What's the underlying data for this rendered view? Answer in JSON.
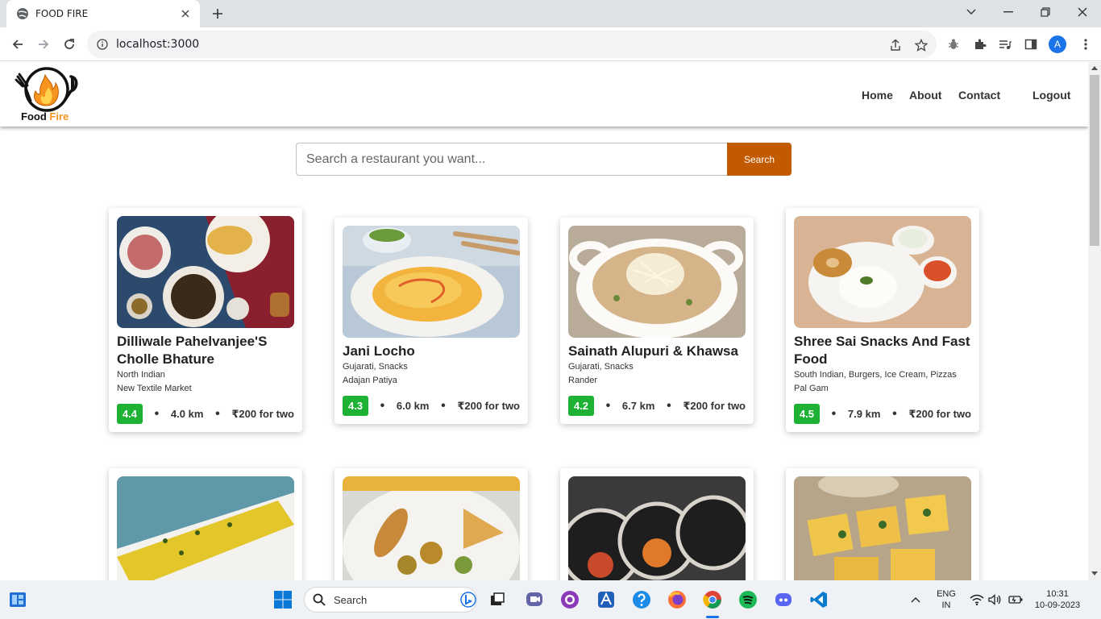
{
  "browser": {
    "tab_title": "FOOD FIRE",
    "url": "localhost:3000",
    "profile_initial": "A"
  },
  "site": {
    "logo_word1": "Food",
    "logo_word2": "Fire",
    "nav": [
      "Home",
      "About",
      "Contact",
      "Logout"
    ],
    "search_placeholder": "Search a restaurant you want...",
    "search_button": "Search",
    "colors": {
      "accent": "#c15a00",
      "rating_green": "#1db233",
      "logo_orange": "#f7941d"
    }
  },
  "restaurants": [
    {
      "name": "Dilliwale Pahelvanjee'S Cholle Bhature",
      "cuisine": "North Indian",
      "area": "New Textile Market",
      "rating": "4.4",
      "distance": "4.0 km",
      "cost": "₹200 for two"
    },
    {
      "name": "Jani Locho",
      "cuisine": "Gujarati, Snacks",
      "area": "Adajan Patiya",
      "rating": "4.3",
      "distance": "6.0 km",
      "cost": "₹200 for two"
    },
    {
      "name": "Sainath Alupuri & Khawsa",
      "cuisine": "Gujarati, Snacks",
      "area": "Rander",
      "rating": "4.2",
      "distance": "6.7 km",
      "cost": "₹200 for two"
    },
    {
      "name": "Shree Sai Snacks And Fast Food",
      "cuisine": "South Indian, Burgers, Ice Cream, Pizzas",
      "area": "Pal Gam",
      "rating": "4.5",
      "distance": "7.9 km",
      "cost": "₹200 for two"
    }
  ],
  "taskbar": {
    "search_label": "Search",
    "lang_line1": "ENG",
    "lang_line2": "IN",
    "time": "10:31",
    "date": "10-09-2023"
  }
}
